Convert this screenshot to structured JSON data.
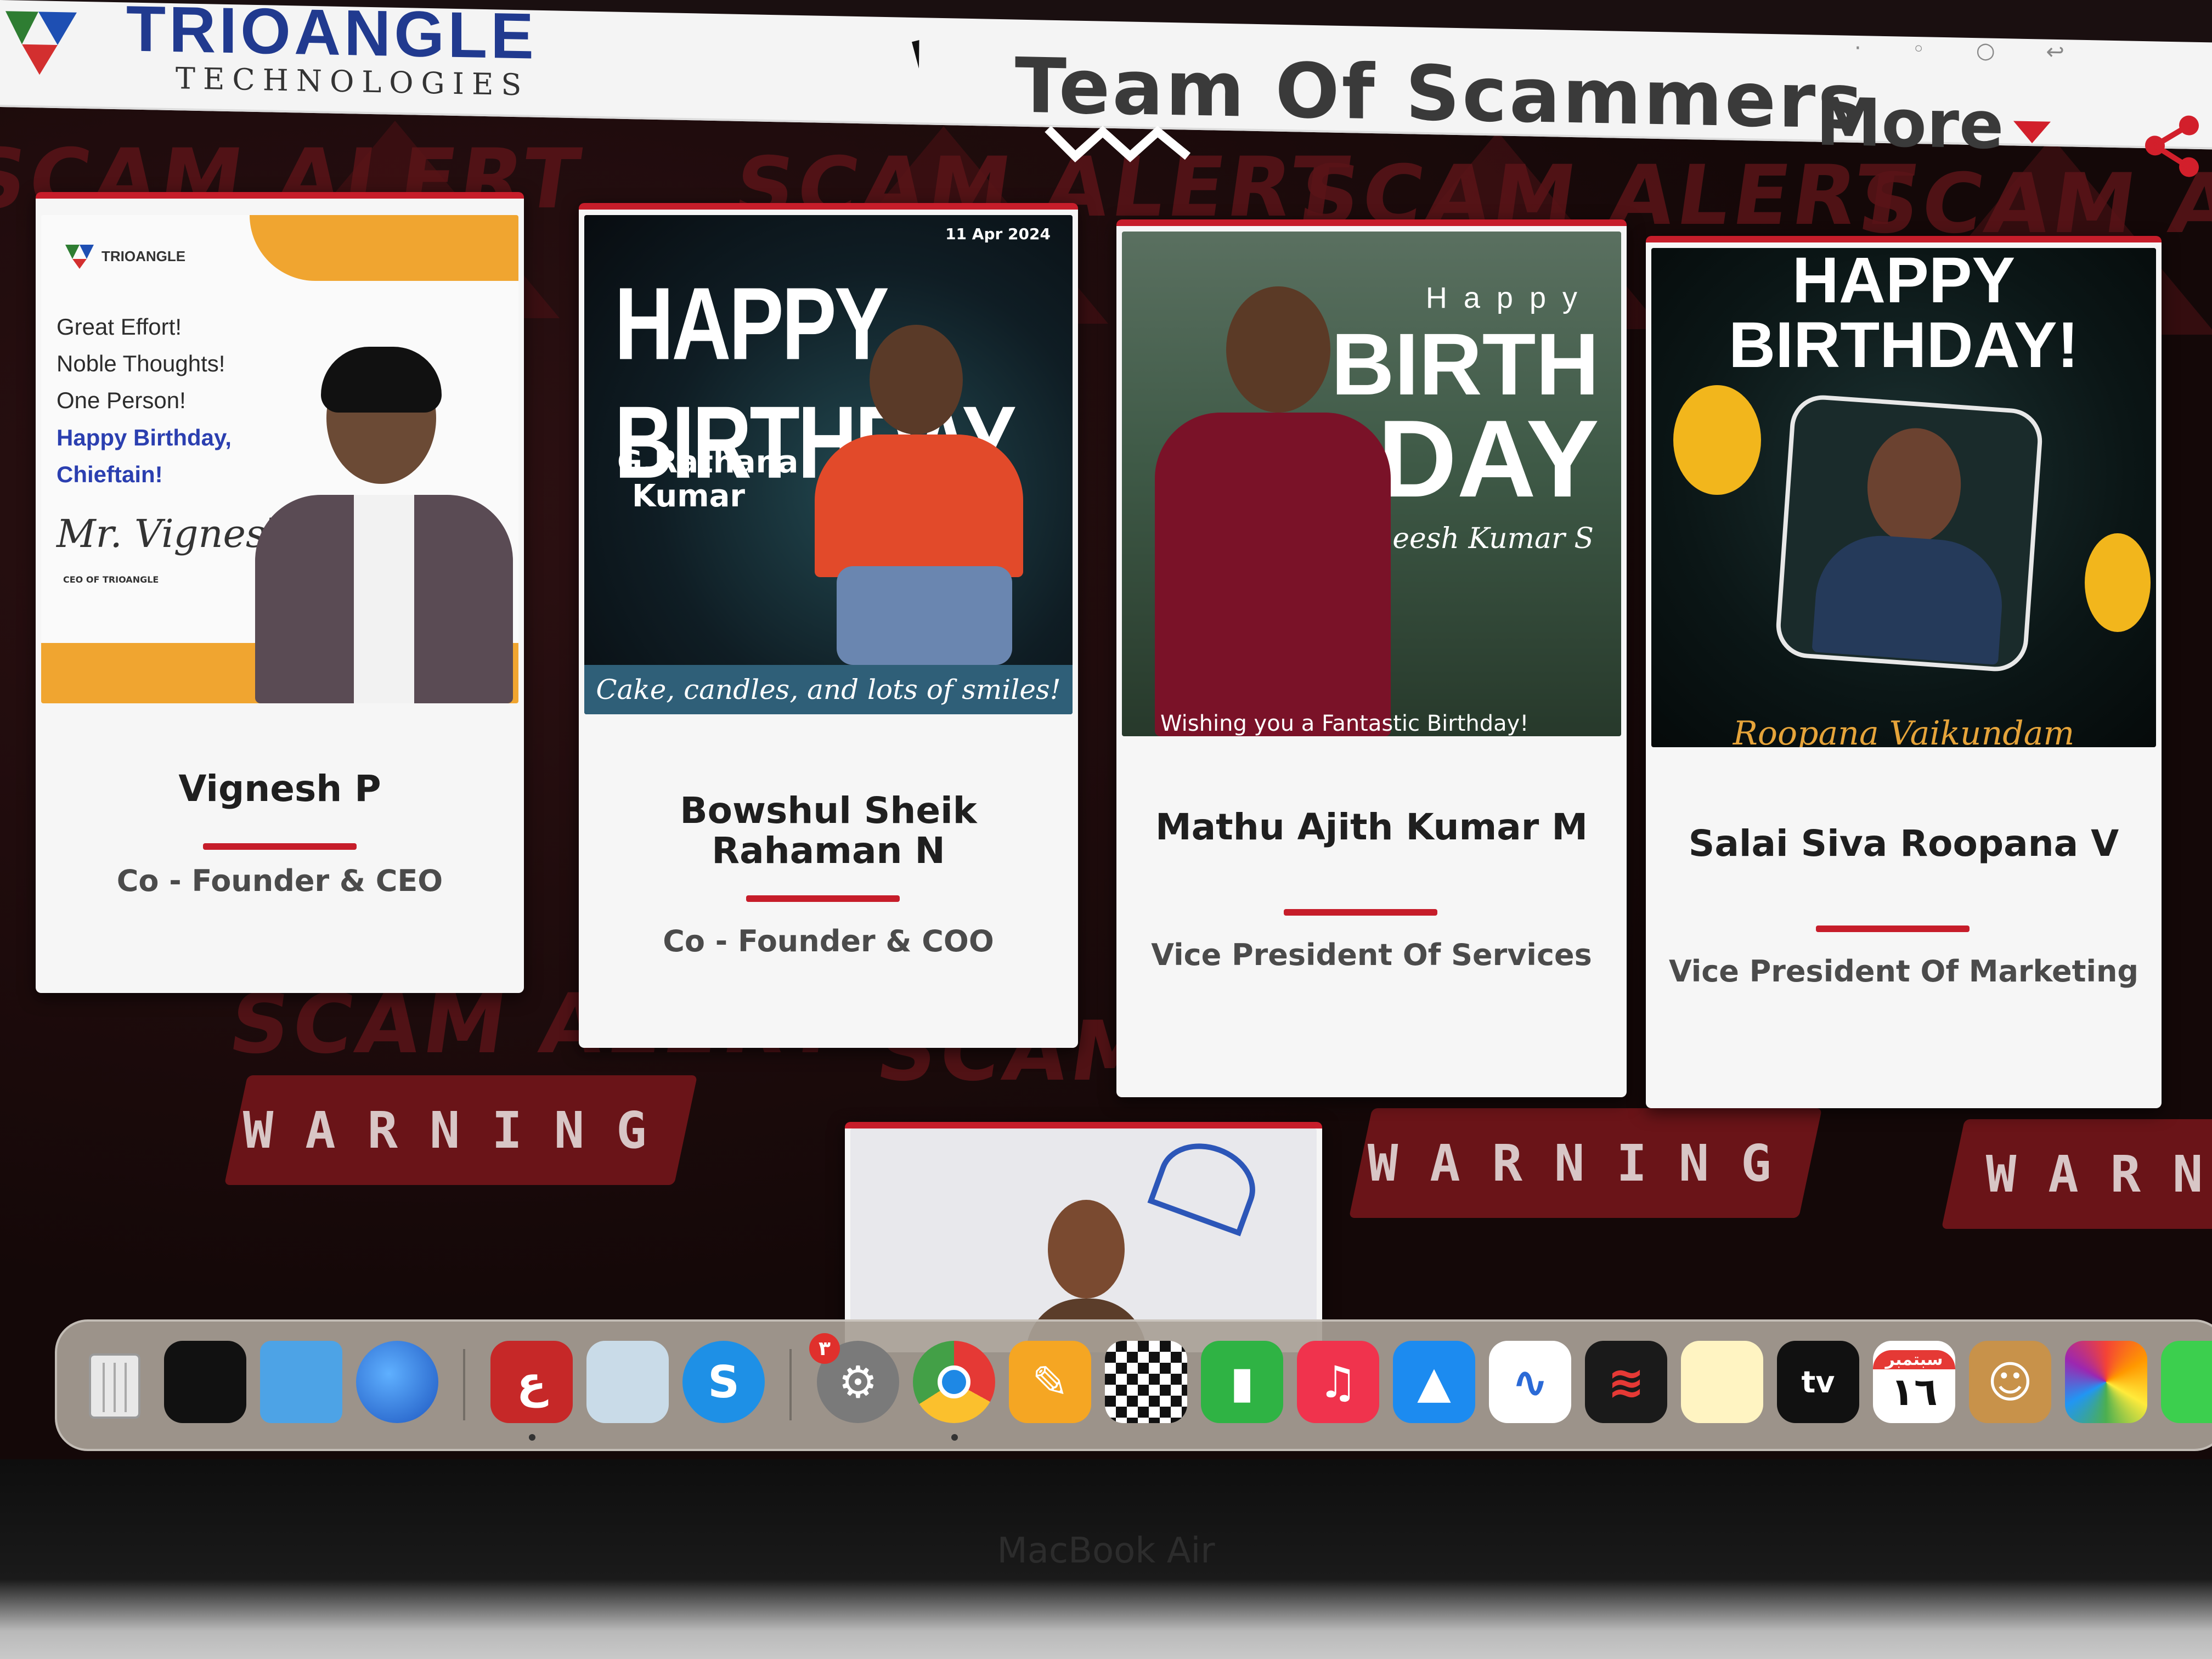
{
  "header": {
    "logo_title": "TRIOANGLE",
    "logo_subtitle": "TECHNOLOGIES",
    "nav_team": "Team Of Scammers",
    "nav_more": "More"
  },
  "background": {
    "banner_word": "SCAM ALERT",
    "warning_word": "WARNING"
  },
  "cards": [
    {
      "name": "Vignesh P",
      "role": "Co - Founder & CEO",
      "photo_lines": [
        "Great Effort!",
        "Noble Thoughts!",
        "One Person!"
      ],
      "photo_highlight": [
        "Happy Birthday,",
        "Chieftain!"
      ],
      "photo_signature": "Mr. Vignesh",
      "photo_caption": "CEO OF TRIOANGLE",
      "photo_brand": "TRIOANGLE"
    },
    {
      "name": "Bowshul Sheik Rahaman N",
      "role": "Co - Founder & COO",
      "photo_title": "HAPPY BIRTHDAY",
      "photo_date": "11 Apr 2024",
      "photo_person": "G.Rathana Kumar",
      "photo_caption": "Cake, candles, and lots of smiles!"
    },
    {
      "name": "Mathu Ajith Kumar M",
      "role": "Vice President Of Services",
      "photo_happy": "Happy",
      "photo_birth": "BIRTH",
      "photo_day": "DAY",
      "photo_signature": "Pratheesh Kumar S",
      "photo_caption": "Wishing you a Fantastic Birthday!"
    },
    {
      "name": "Salai Siva Roopana V",
      "role": "Vice President Of Marketing",
      "photo_title_1": "HAPPY",
      "photo_title_2": "BIRTHDAY!",
      "photo_signature": "Roopana Vaikundam"
    }
  ],
  "dock": {
    "badge_count": "٣",
    "calendar_month": "سبتمبر",
    "calendar_day": "١٦",
    "apps": [
      "trash-icon",
      "terminal-icon",
      "finder-folder-icon",
      "globe-icon",
      "arabic-app-icon",
      "preview-icon",
      "skype-icon",
      "system-settings-icon",
      "chrome-icon",
      "pages-icon",
      "chess-icon",
      "numbers-icon",
      "music-icon",
      "keynote-icon",
      "freeform-icon",
      "voice-memos-icon",
      "notes-icon",
      "apple-tv-icon",
      "calendar-icon",
      "contacts-icon",
      "photos-icon",
      "messages-icon"
    ]
  },
  "device_label": "MacBook Air"
}
